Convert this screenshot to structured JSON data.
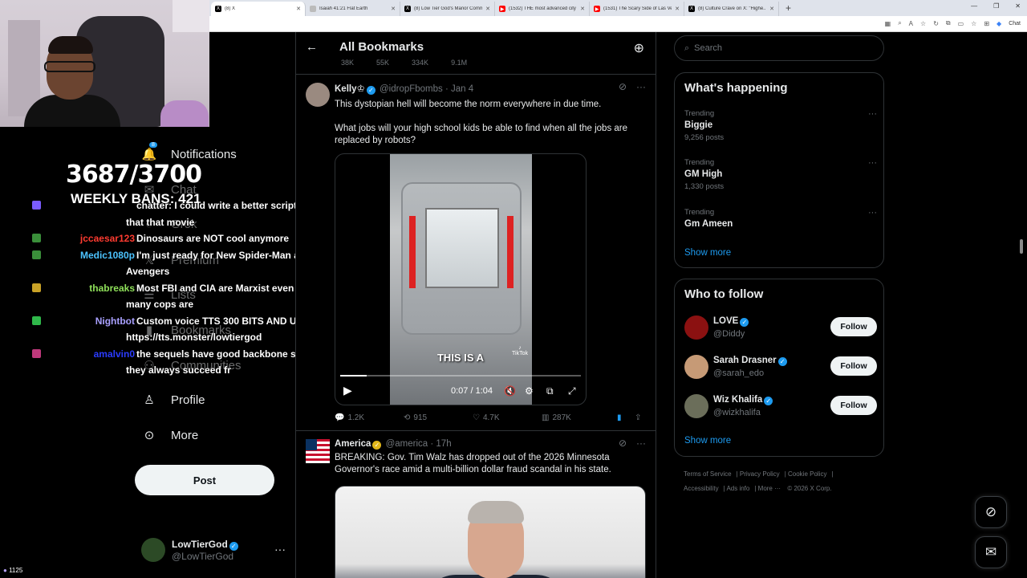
{
  "browser": {
    "tabs": [
      {
        "title": "(8) X",
        "fav_color": "#000",
        "fav_glyph": "X",
        "active": true
      },
      {
        "title": "Isaiah 41:21 Flat Earth",
        "fav_color": "#bbb",
        "fav_glyph": "",
        "active": false
      },
      {
        "title": "(8) Low Tier God's Manor Comm...",
        "fav_color": "#000",
        "fav_glyph": "X",
        "active": false
      },
      {
        "title": "(1532) THE most advanced city in...",
        "fav_color": "#f00",
        "fav_glyph": "▶",
        "active": false
      },
      {
        "title": "(1531) The Scary Side of Las Vega...",
        "fav_color": "#f00",
        "fav_glyph": "▶",
        "active": false
      },
      {
        "title": "(8) Culture Crave on X: \"Highe...",
        "fav_color": "#000",
        "fav_glyph": "X",
        "active": false
      }
    ],
    "new_tab": "+",
    "chat_label": "Chat"
  },
  "overlay": {
    "counter": "3687/3700",
    "weekly_bans": "WEEKLY BANS: 421",
    "viewers": "1125",
    "chat": [
      {
        "user": "",
        "msg": "chatter: I could write a better script",
        "color": "#7b5cff",
        "badge": "#7b5cff"
      },
      {
        "user": "",
        "msg": "that that movie",
        "color": "#fff",
        "badge": ""
      },
      {
        "user": "jccaesar123",
        "msg": "Dinosaurs are NOT cool anymore",
        "color": "#ff3b30",
        "badge": "#3a8f3a"
      },
      {
        "user": "Medic1080p",
        "msg": "I'm just ready for New Spider-Man and",
        "color": "#4cc3ff",
        "badge": "#3a8f3a"
      },
      {
        "user": "",
        "msg": "Avengers",
        "color": "#fff",
        "badge": ""
      },
      {
        "user": "thabreaks",
        "msg": "Most FBI and CIA are Marxist even",
        "color": "#8fe05a",
        "badge": "#c9a227"
      },
      {
        "user": "",
        "msg": "many cops are",
        "color": "#fff",
        "badge": ""
      },
      {
        "user": "Nightbot",
        "msg": "Custom voice TTS 300 BITS AND UP",
        "color": "#a9a0ff",
        "badge": "#2fb84a"
      },
      {
        "user": "",
        "msg": "https://tts.monster/lowtiergod",
        "color": "#fff",
        "badge": ""
      },
      {
        "user": "amalvin0",
        "msg": "the sequels have good backbone so",
        "color": "#2b3cff",
        "badge": "#c0397c"
      },
      {
        "user": "",
        "msg": "they always succeed fr",
        "color": "#fff",
        "badge": ""
      }
    ]
  },
  "nav": {
    "items": [
      {
        "label": "Notifications",
        "icon": "bell-icon",
        "glyph": "🔔",
        "faded": false,
        "badge": "8"
      },
      {
        "label": "Chat",
        "icon": "envelope-icon",
        "glyph": "✉",
        "faded": true
      },
      {
        "label": "Grok",
        "icon": "grok-icon",
        "glyph": "◌",
        "faded": true
      },
      {
        "label": "Premium",
        "icon": "x-logo-icon",
        "glyph": "𝕏",
        "faded": true
      },
      {
        "label": "Lists",
        "icon": "list-icon",
        "glyph": "☰",
        "faded": true
      },
      {
        "label": "Bookmarks",
        "icon": "bookmark-icon",
        "glyph": "🔖",
        "faded": true
      },
      {
        "label": "Communities",
        "icon": "people-icon",
        "glyph": "👥",
        "faded": true
      },
      {
        "label": "Profile",
        "icon": "person-icon",
        "glyph": "👤",
        "faded": false
      },
      {
        "label": "More",
        "icon": "more-circle-icon",
        "glyph": "⋯",
        "faded": false
      }
    ],
    "post_label": "Post",
    "account": {
      "name": "LowTierGod",
      "handle": "@LowTierGod"
    }
  },
  "main": {
    "header_title": "All Bookmarks",
    "prev_actions": [
      "38K",
      "55K",
      "334K",
      "9.1M"
    ],
    "tweet1": {
      "name": "Kelly♔",
      "handle": "@idropFbombs",
      "date": "Jan 4",
      "text1": "This dystopian hell will become the norm everywhere in due time.",
      "text2": "What jobs will your high school kids be able to find when all the jobs are replaced by robots?",
      "video_caption": "THIS IS A",
      "video_watermark": "TikTok",
      "video_time": "0:07 / 1:04",
      "progress": 0.11,
      "replies": "1.2K",
      "reposts": "915",
      "likes": "4.7K",
      "views": "287K"
    },
    "tweet2": {
      "name": "America",
      "handle": "@america",
      "date": "17h",
      "text": "BREAKING: Gov. Tim Walz has dropped out of the 2026 Minnesota Governor's race amid a multi-billion dollar fraud scandal in his state."
    }
  },
  "right": {
    "search_placeholder": "Search",
    "happening_title": "What's happening",
    "trends": [
      {
        "label": "Trending",
        "name": "Biggie",
        "count": "9,256 posts"
      },
      {
        "label": "Trending",
        "name": "GM High",
        "count": "1,330 posts"
      },
      {
        "label": "Trending",
        "name": "Gm Ameen",
        "count": ""
      }
    ],
    "show_more": "Show more",
    "wtf_title": "Who to follow",
    "follow": [
      {
        "name": "LOVE",
        "handle": "@Diddy",
        "color": "#8b1111"
      },
      {
        "name": "Sarah Drasner",
        "handle": "@sarah_edo",
        "color": "#c69a76"
      },
      {
        "name": "Wiz Khalifa",
        "handle": "@wizkhalifa",
        "color": "#6b6e5a"
      }
    ],
    "follow_label": "Follow",
    "footer": [
      "Terms of Service",
      "Privacy Policy",
      "Cookie Policy",
      "Accessibility",
      "Ads info",
      "More ···",
      "© 2026 X Corp."
    ]
  }
}
